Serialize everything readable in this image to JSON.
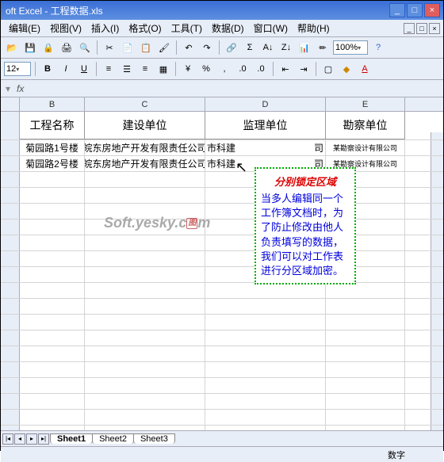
{
  "window": {
    "title": "oft Excel - 工程数据.xls"
  },
  "menu": {
    "edit": "编辑(E)",
    "view": "视图(V)",
    "insert": "插入(I)",
    "format": "格式(O)",
    "tools": "工具(T)",
    "data": "数据(D)",
    "window": "窗口(W)",
    "help": "帮助(H)"
  },
  "format_tb": {
    "fontsize": "12",
    "zoom": "100%"
  },
  "columns": [
    "B",
    "C",
    "D",
    "E"
  ],
  "header": {
    "B": "工程名称",
    "C": "建设单位",
    "D": "监理单位",
    "E": "勘察单位"
  },
  "rows": [
    {
      "B": "菊园路1号楼",
      "C": "皖东房地产开发有限责任公司",
      "D": "市科建",
      "D2": "司",
      "E": "某勘察设计有限公司"
    },
    {
      "B": "菊园路2号楼",
      "C": "皖东房地产开发有限责任公司",
      "D": "市科建",
      "D2": "司",
      "E": "某勘察设计有限公司"
    }
  ],
  "callout": {
    "title": "分别锁定区域",
    "body": "当多人编辑同一个工作簿文档时，为了防止修改由他人负责填写的数据，我们可以对工作表进行分区域加密。"
  },
  "watermark": "Soft.yesky.c  m",
  "tabs": {
    "s1": "Sheet1",
    "s2": "Sheet2",
    "s3": "Sheet3"
  },
  "status": {
    "mode": "数字"
  }
}
